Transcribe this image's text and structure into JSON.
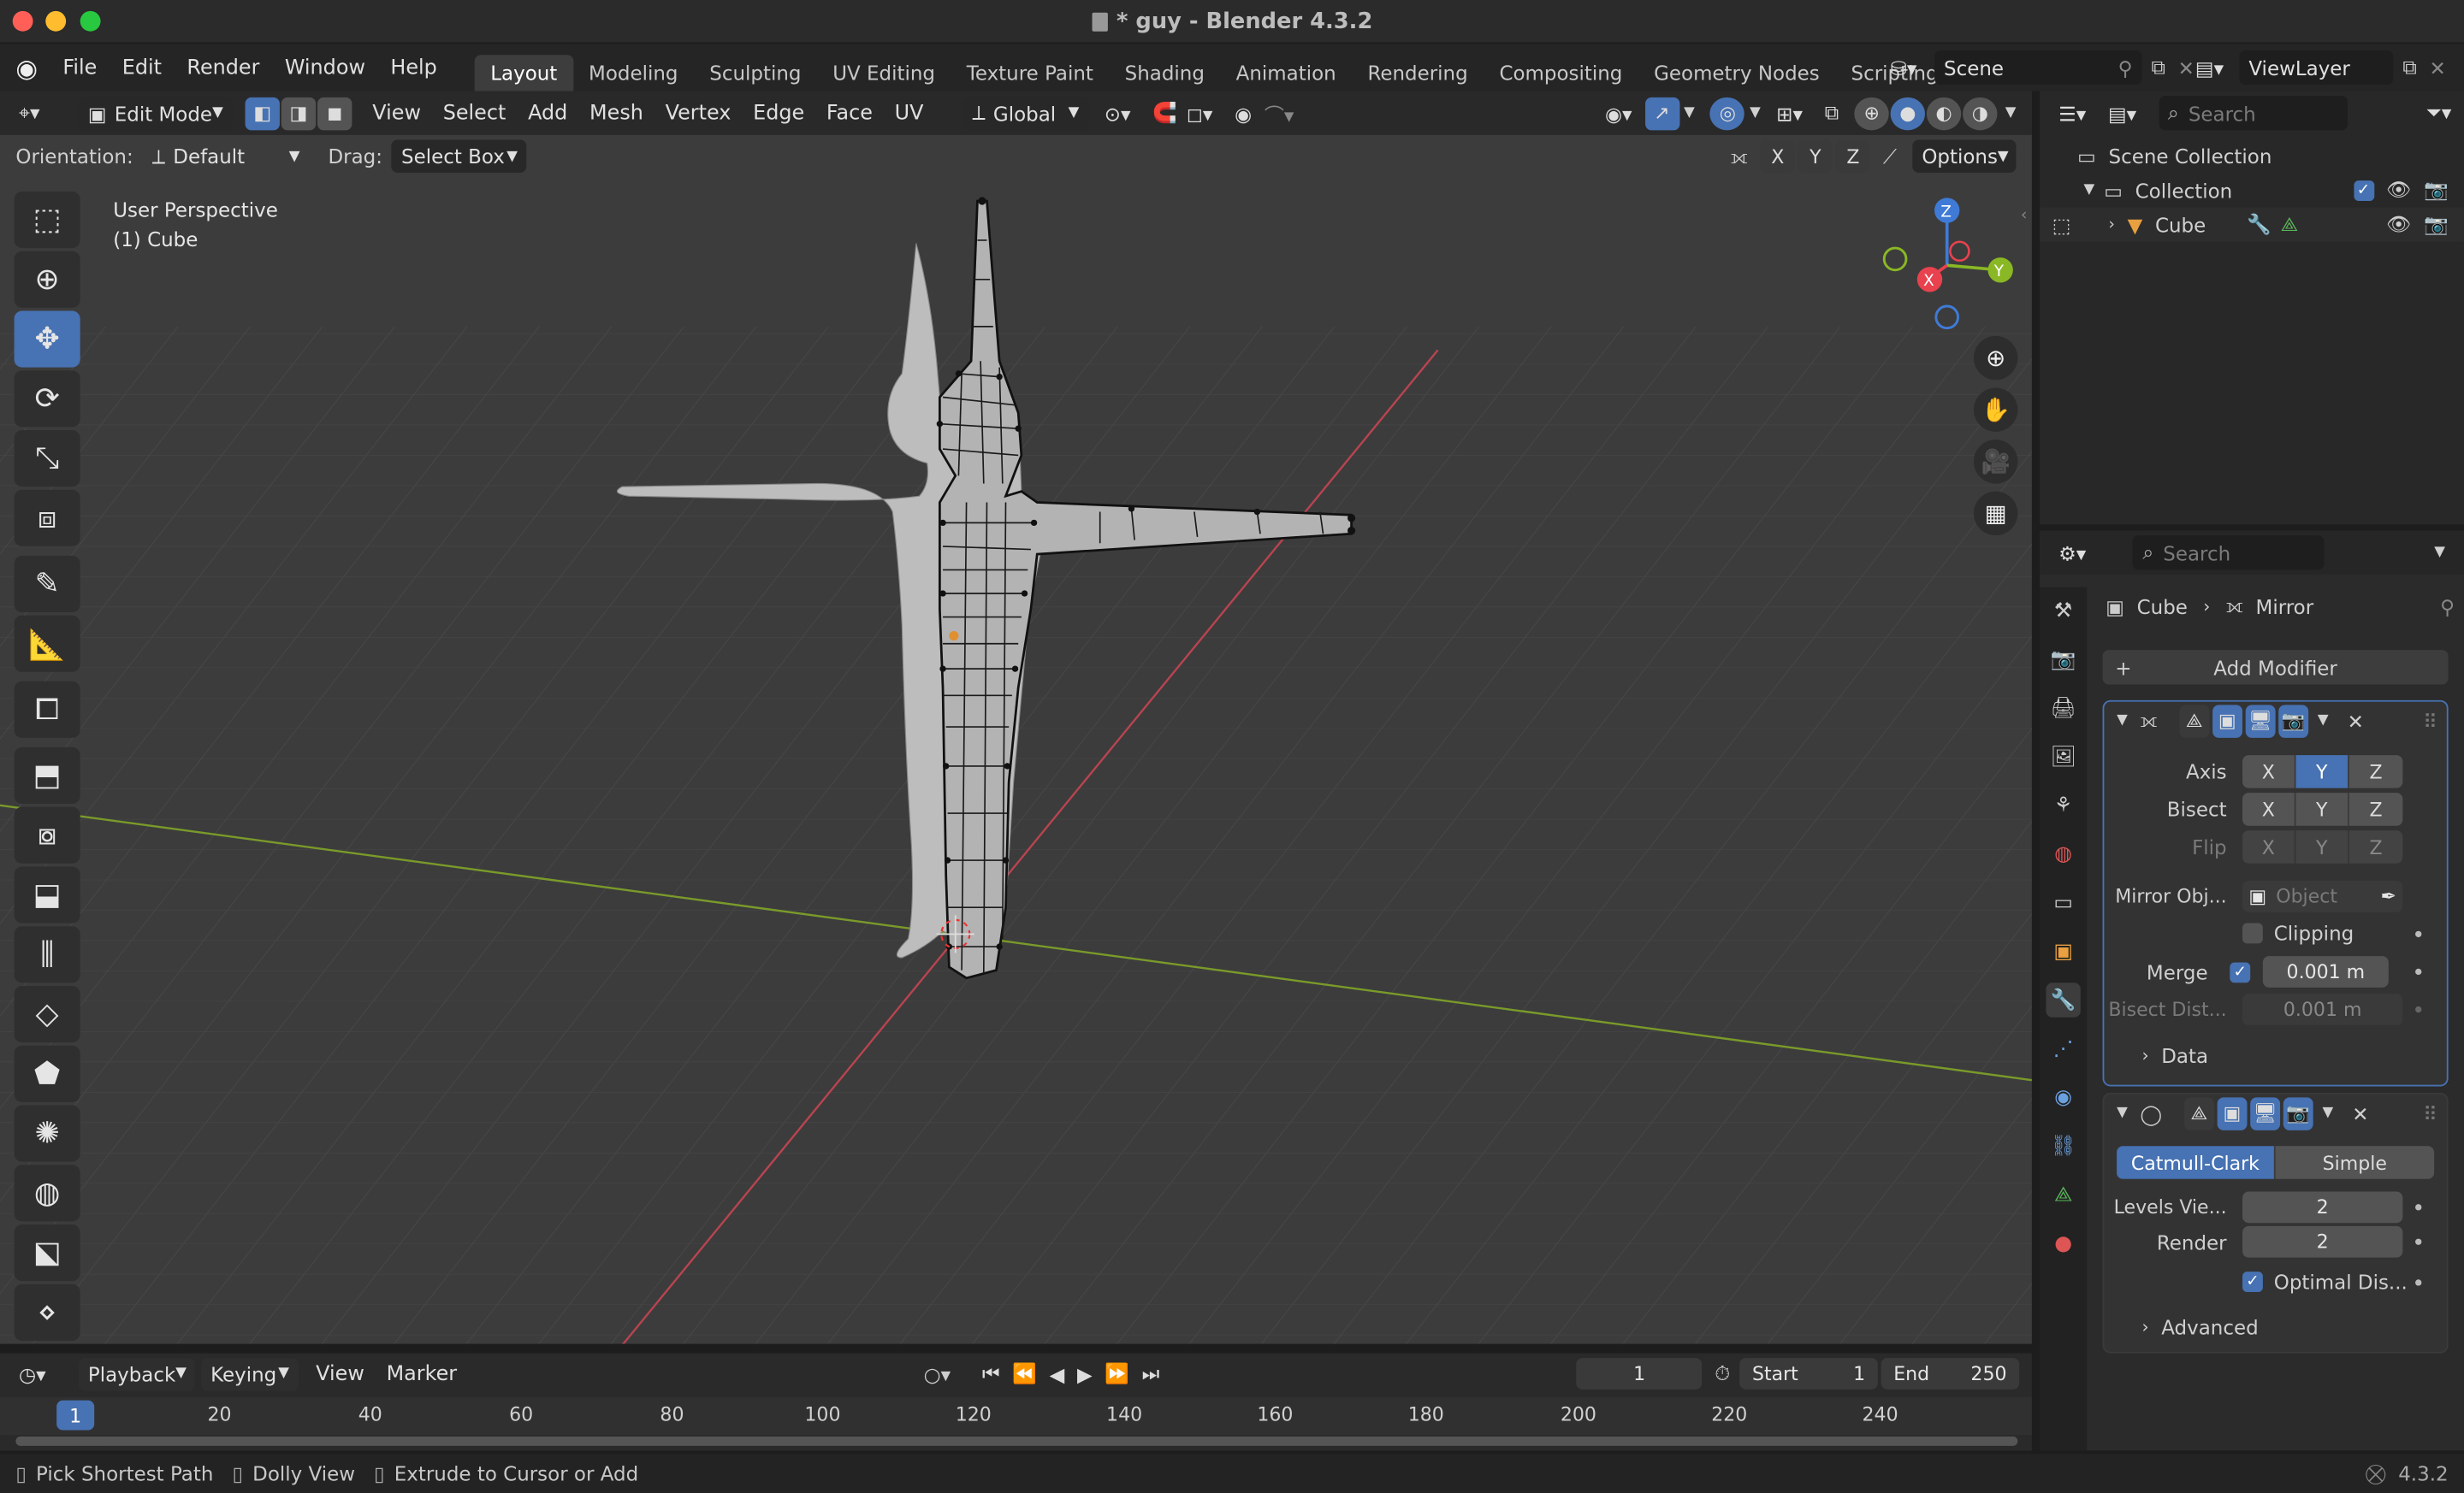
{
  "window": {
    "title": "* guy - Blender 4.3.2"
  },
  "menu": [
    "File",
    "Edit",
    "Render",
    "Window",
    "Help"
  ],
  "workspaces": [
    "Layout",
    "Modeling",
    "Sculpting",
    "UV Editing",
    "Texture Paint",
    "Shading",
    "Animation",
    "Rendering",
    "Compositing",
    "Geometry Nodes",
    "Scripting"
  ],
  "active_workspace": "Layout",
  "scene": {
    "name": "Scene",
    "view_layer": "ViewLayer"
  },
  "viewport": {
    "mode": "Edit Mode",
    "menus": [
      "View",
      "Select",
      "Add",
      "Mesh",
      "Vertex",
      "Edge",
      "Face",
      "UV"
    ],
    "transform_orientation": "Global",
    "orientation_label": "Orientation:",
    "orientation_value": "Default",
    "drag_label": "Drag:",
    "drag_value": "Select Box",
    "options_label": "Options",
    "axis_toggles": [
      "X",
      "Y",
      "Z"
    ],
    "overlay_title": "User Perspective",
    "overlay_object": "(1) Cube",
    "gizmo": {
      "x": "X",
      "y": "Y",
      "z": "Z"
    }
  },
  "outliner": {
    "search_placeholder": "Search",
    "scene_collection": "Scene Collection",
    "collection": "Collection",
    "object": "Cube"
  },
  "properties": {
    "search_placeholder": "Search",
    "breadcrumb_object": "Cube",
    "breadcrumb_modifier": "Mirror",
    "add_modifier": "Add Modifier",
    "mirror": {
      "axis_label": "Axis",
      "bisect_label": "Bisect",
      "flip_label": "Flip",
      "axes": [
        "X",
        "Y",
        "Z"
      ],
      "axis_active": "Y",
      "mirror_object_label": "Mirror Obj...",
      "mirror_object_placeholder": "Object",
      "clipping_label": "Clipping",
      "clipping": false,
      "merge_label": "Merge",
      "merge": true,
      "merge_value": "0.001 m",
      "bisect_dist_label": "Bisect Dist...",
      "bisect_dist_value": "0.001 m",
      "data_label": "Data"
    },
    "subsurf": {
      "catmull": "Catmull-Clark",
      "simple": "Simple",
      "levels_label": "Levels Vie...",
      "levels_value": "2",
      "render_label": "Render",
      "render_value": "2",
      "optimal_label": "Optimal Dis...",
      "optimal": true,
      "advanced_label": "Advanced"
    }
  },
  "timeline": {
    "menus": [
      "Playback",
      "Keying",
      "View",
      "Marker"
    ],
    "current_frame": "1",
    "start_label": "Start",
    "start": "1",
    "end_label": "End",
    "end": "250",
    "ticks": [
      "1",
      "20",
      "40",
      "60",
      "80",
      "100",
      "120",
      "140",
      "160",
      "180",
      "200",
      "220",
      "240"
    ]
  },
  "status": {
    "hints": [
      "Pick Shortest Path",
      "Dolly View",
      "Extrude to Cursor or Add"
    ],
    "version": "4.3.2"
  },
  "colors": {
    "accent": "#4772b3",
    "x_axis": "#e8424f",
    "y_axis": "#8ab825",
    "z_axis": "#3f7bd6"
  }
}
